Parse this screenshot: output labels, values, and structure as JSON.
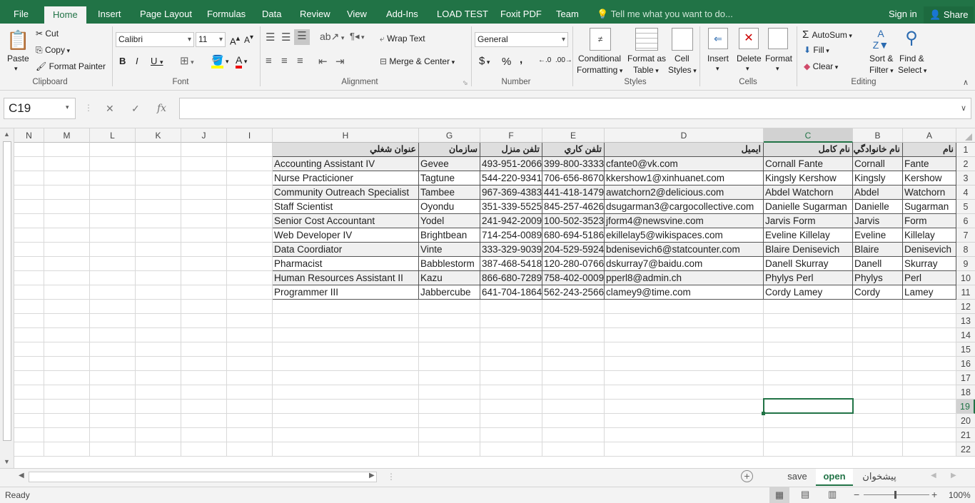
{
  "menu": {
    "tabs": [
      "File",
      "Home",
      "Insert",
      "Page Layout",
      "Formulas",
      "Data",
      "Review",
      "View",
      "Add-Ins",
      "LOAD TEST",
      "Foxit PDF",
      "Team"
    ],
    "active_tab": "Home",
    "tell_me": "Tell me what you want to do...",
    "signin": "Sign in",
    "share": "Share"
  },
  "ribbon": {
    "clipboard": {
      "paste": "Paste",
      "cut": "Cut",
      "copy": "Copy",
      "format_painter": "Format Painter",
      "label": "Clipboard"
    },
    "font": {
      "name": "Calibri",
      "size": "11",
      "label": "Font"
    },
    "alignment": {
      "wrap_text": "Wrap Text",
      "merge_center": "Merge & Center",
      "label": "Alignment"
    },
    "number": {
      "format": "General",
      "label": "Number"
    },
    "styles": {
      "conditional": "Conditional",
      "conditional2": "Formatting",
      "format_as": "Format as",
      "format_as2": "Table",
      "cell": "Cell",
      "cell2": "Styles",
      "label": "Styles"
    },
    "cells": {
      "insert": "Insert",
      "delete": "Delete",
      "format": "Format",
      "label": "Cells"
    },
    "editing": {
      "autosum": "AutoSum",
      "fill": "Fill",
      "clear": "Clear",
      "sort": "Sort &",
      "sort2": "Filter",
      "find": "Find &",
      "find2": "Select",
      "label": "Editing"
    }
  },
  "formula_bar": {
    "name_box": "C19",
    "value": ""
  },
  "columns": [
    "N",
    "M",
    "L",
    "K",
    "J",
    "I",
    "H",
    "G",
    "F",
    "E",
    "D",
    "C",
    "B",
    "A"
  ],
  "selected_column": "C",
  "rows": [
    "1",
    "2",
    "3",
    "4",
    "5",
    "6",
    "7",
    "8",
    "9",
    "10",
    "11",
    "12",
    "13",
    "14",
    "15",
    "16",
    "17",
    "18",
    "19",
    "20",
    "21",
    "22"
  ],
  "selected_row": "19",
  "table": {
    "headers": {
      "H": "عنوان شغلي",
      "G": "سازمان",
      "F": "تلفن منزل",
      "E": "تلفن كاري",
      "D": "ايميل",
      "C": "نام كامل",
      "B": "نام خانوادگي",
      "A": "نام"
    },
    "rows": [
      {
        "A": "Fante",
        "B": "Cornall",
        "C": "Cornall Fante",
        "D": "cfante0@vk.com",
        "E": "399-800-3333",
        "F": "493-951-2066",
        "G": "Gevee",
        "H": "Accounting Assistant IV"
      },
      {
        "A": "Kershow",
        "B": "Kingsly",
        "C": "Kingsly Kershow",
        "D": "kkershow1@xinhuanet.com",
        "E": "706-656-8670",
        "F": "544-220-9341",
        "G": "Tagtune",
        "H": "Nurse Practicioner"
      },
      {
        "A": "Watchorn",
        "B": "Abdel",
        "C": "Abdel Watchorn",
        "D": "awatchorn2@delicious.com",
        "E": "441-418-1479",
        "F": "967-369-4383",
        "G": "Tambee",
        "H": "Community Outreach Specialist"
      },
      {
        "A": "Sugarman",
        "B": "Danielle",
        "C": "Danielle Sugarman",
        "D": "dsugarman3@cargocollective.com",
        "E": "845-257-4626",
        "F": "351-339-5525",
        "G": "Oyondu",
        "H": "Staff Scientist"
      },
      {
        "A": "Form",
        "B": "Jarvis",
        "C": "Jarvis Form",
        "D": "jform4@newsvine.com",
        "E": "100-502-3523",
        "F": "241-942-2009",
        "G": "Yodel",
        "H": "Senior Cost Accountant"
      },
      {
        "A": "Killelay",
        "B": "Eveline",
        "C": "Eveline Killelay",
        "D": "ekillelay5@wikispaces.com",
        "E": "680-694-5186",
        "F": "714-254-0089",
        "G": "Brightbean",
        "H": "Web Developer IV"
      },
      {
        "A": "Denisevich",
        "B": "Blaire",
        "C": "Blaire Denisevich",
        "D": "bdenisevich6@statcounter.com",
        "E": "204-529-5924",
        "F": "333-329-9039",
        "G": "Vinte",
        "H": "Data Coordiator"
      },
      {
        "A": "Skurray",
        "B": "Danell",
        "C": "Danell Skurray",
        "D": "dskurray7@baidu.com",
        "E": "120-280-0766",
        "F": "387-468-5418",
        "G": "Babblestorm",
        "H": "Pharmacist"
      },
      {
        "A": "Perl",
        "B": "Phylys",
        "C": "Phylys Perl",
        "D": "pperl8@admin.ch",
        "E": "758-402-0009",
        "F": "866-680-7289",
        "G": "Kazu",
        "H": "Human Resources Assistant II"
      },
      {
        "A": "Lamey",
        "B": "Cordy",
        "C": "Cordy Lamey",
        "D": "clamey9@time.com",
        "E": "562-243-2566",
        "F": "641-704-1864",
        "G": "Jabbercube",
        "H": "Programmer III"
      }
    ]
  },
  "sheets": [
    "save",
    "open",
    "پیشخوان"
  ],
  "active_sheet": "open",
  "status": {
    "text": "Ready",
    "zoom": "100%"
  },
  "colors": {
    "accent": "#217346",
    "header_fill": "#dedede",
    "alt_row": "#f0f0f0"
  }
}
